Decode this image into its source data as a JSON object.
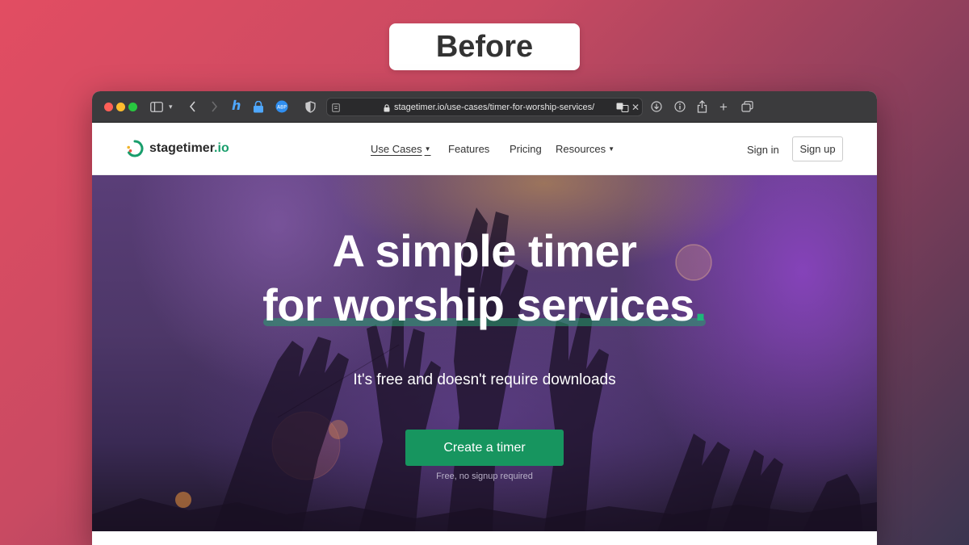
{
  "label": "Before",
  "browser": {
    "url": "stagetimer.io/use-cases/timer-for-worship-services/",
    "extension_badge": "ABP"
  },
  "nav": {
    "logo_name": "stagetimer",
    "logo_tld": ".io",
    "links": [
      "Use Cases",
      "Features",
      "Pricing",
      "Resources"
    ],
    "sign_in": "Sign in",
    "sign_up": "Sign up"
  },
  "hero": {
    "title_line1": "A simple timer",
    "title_line2": "for worship services",
    "title_dot": ".",
    "subtitle": "It's free and doesn't require downloads",
    "cta": "Create a timer",
    "cta_note": "Free, no signup required"
  },
  "colors": {
    "brand_green": "#17955f",
    "accent_dot": "#1fb57a"
  }
}
